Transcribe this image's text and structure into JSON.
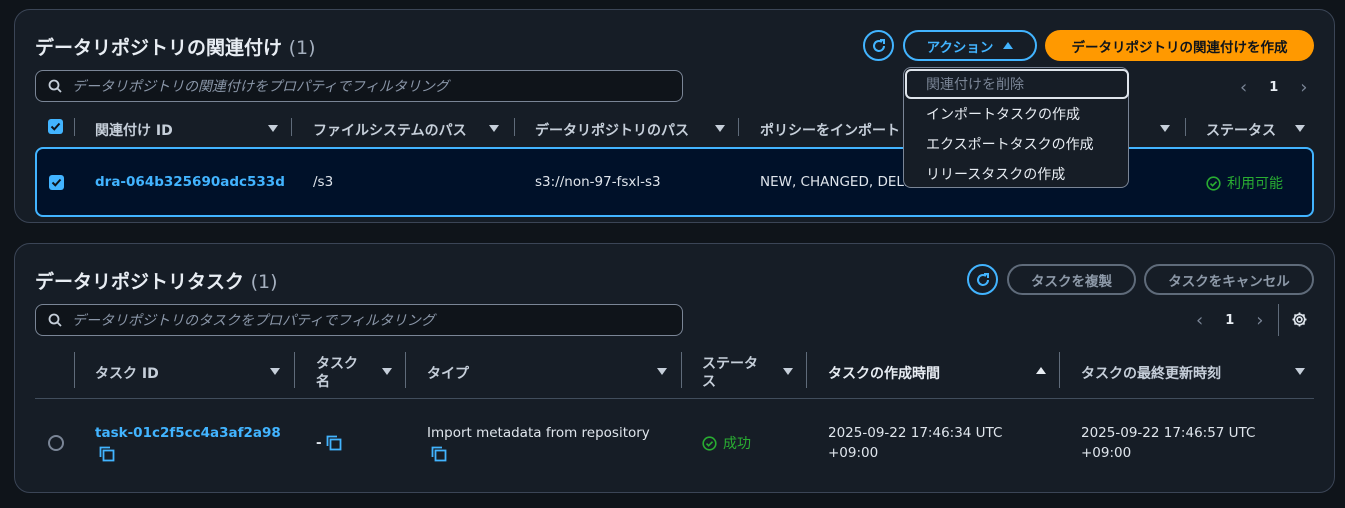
{
  "assoc": {
    "title": "データリポジトリの関連付け",
    "count": "(1)",
    "actions_label": "アクション",
    "create_label": "データリポジトリの関連付けを作成",
    "search_placeholder": "データリポジトリの関連付けをプロパティでフィルタリング",
    "page": "1",
    "columns": [
      "関連付け ID",
      "ファイルシステムのパス",
      "データリポジトリのパス",
      "ポリシーをインポート",
      "ステータス"
    ],
    "row": {
      "id": "dra-064b325690adc533d",
      "fs_path": "/s3",
      "repo_path": "s3://non-97-fsxl-s3",
      "policy": "NEW, CHANGED, DELETED",
      "status": "利用可能"
    },
    "menu": [
      "関連付けを削除",
      "インポートタスクの作成",
      "エクスポートタスクの作成",
      "リリースタスクの作成"
    ]
  },
  "tasks": {
    "title": "データリポジトリタスク",
    "count": "(1)",
    "duplicate_label": "タスクを複製",
    "cancel_label": "タスクをキャンセル",
    "search_placeholder": "データリポジトリのタスクをプロパティでフィルタリング",
    "page": "1",
    "columns": {
      "id": "タスク ID",
      "name_1": "タスク",
      "name_2": "名",
      "type": "タイプ",
      "status_1": "ステータ",
      "status_2": "ス",
      "created": "タスクの作成時間",
      "updated": "タスクの最終更新時刻"
    },
    "row": {
      "id": "task-01c2f5cc4a3af2a98",
      "name": "-",
      "type": "Import metadata from repository",
      "status": "成功",
      "created_1": "2025-09-22 17:46:34 UTC",
      "created_2": "+09:00",
      "updated_1": "2025-09-22 17:46:57 UTC",
      "updated_2": "+09:00"
    }
  },
  "colors": {
    "accent": "#42b4ff",
    "primary": "#ff9900",
    "success": "#29ad32",
    "background": "#0f141a"
  }
}
